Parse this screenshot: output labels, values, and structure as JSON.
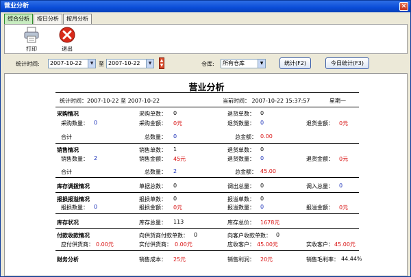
{
  "window": {
    "title": "营业分析",
    "close": "×"
  },
  "tabs": [
    "综合分析",
    "按日分析",
    "按月分析"
  ],
  "toolbar": {
    "print": "打印",
    "exit": "退出"
  },
  "filter": {
    "time_label": "统计时间:",
    "start_date": "2007-10-22",
    "to": "至",
    "end_date": "2007-10-22",
    "warehouse_label": "仓库:",
    "warehouse": "所有仓库",
    "stat_btn": "统计(F2)",
    "today_btn": "今日统计(F3)"
  },
  "report": {
    "title": "营业分析",
    "header": {
      "range": "统计时间：2007-10-22 至 2007-10-22",
      "now": "当前时间：  2007-10-22 15:37:57",
      "weekday": "星期一"
    },
    "purchase": {
      "title": "采购情况",
      "r1": [
        "采购单数：",
        "0",
        "退货单数：",
        "0"
      ],
      "r2": [
        "采购数量：",
        "0",
        "采购金额：",
        "0元",
        "退货数量：",
        "0",
        "退货金额：",
        "0元"
      ],
      "total": [
        "合计",
        "总数量：",
        "0",
        "总金额：",
        "0.00"
      ]
    },
    "sales": {
      "title": "销售情况",
      "r1": [
        "销售单数：",
        "1",
        "退货单数：",
        "0"
      ],
      "r2": [
        "销售数量：",
        "2",
        "销售金额：",
        "45元",
        "退货数量：",
        "0",
        "退货金额：",
        "0元"
      ],
      "total": [
        "合计",
        "总数量：",
        "2",
        "总金额：",
        "45.00"
      ]
    },
    "transfer": {
      "title": "库存调拨情况",
      "items": [
        "单据总数：",
        "0",
        "调出总量：",
        "0",
        "调入总量：",
        "0"
      ]
    },
    "loss": {
      "title": "报损报溢情况",
      "r1": [
        "报损单数：",
        "0",
        "报溢单数：",
        "0"
      ],
      "r2": [
        "报损数量：",
        "0",
        "报损金额：",
        "0元",
        "报溢数量：",
        "0",
        "报溢金额：",
        "0元"
      ]
    },
    "stock": {
      "title": "库存状况",
      "items": [
        "库存总量：",
        "113",
        "库存总价：",
        "1678元"
      ]
    },
    "payment": {
      "title": "付款收款情况",
      "r1": [
        "向供货商付款单数：",
        "0",
        "向客户收款单数：",
        "0"
      ],
      "r2": [
        "应付供货商：",
        "0.00元",
        "实付供货商：",
        "0.00元",
        "应收客户：",
        "45.00元",
        "实收客户：",
        "45.00元"
      ]
    },
    "finance": {
      "title": "财务分析",
      "items": [
        "销售成本：",
        "25元",
        "销售利润：",
        "20元",
        "销售毛利率：",
        "44.44%"
      ]
    }
  }
}
